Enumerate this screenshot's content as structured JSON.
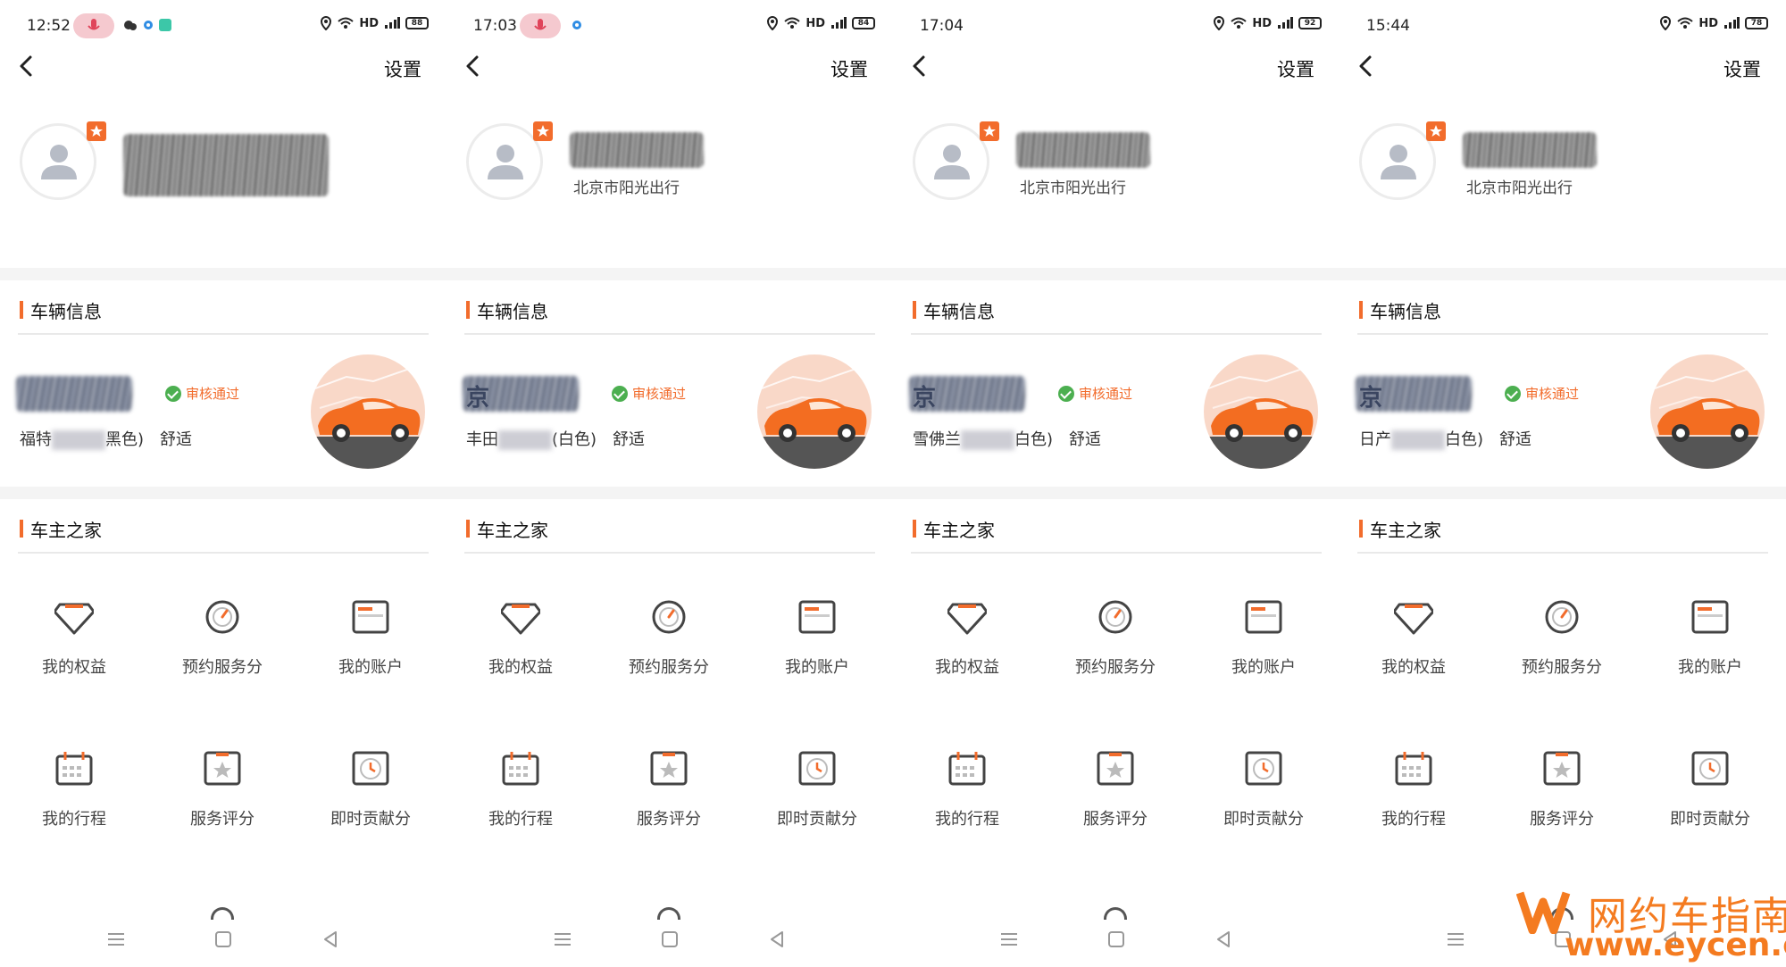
{
  "colors": {
    "accent": "#f26c2c",
    "ok_green": "#4caf50",
    "watermark": "#f47b20"
  },
  "header": {
    "settings_label": "设置"
  },
  "sections": {
    "vehicle_title": "车辆信息",
    "home_title": "车主之家"
  },
  "vehicle_status": "审核通过",
  "service_level": "舒适",
  "grid": [
    {
      "label": "我的权益",
      "icon": "diamond-icon"
    },
    {
      "label": "预约服务分",
      "icon": "speedometer-icon"
    },
    {
      "label": "我的账户",
      "icon": "wallet-card-icon"
    },
    {
      "label": "我的行程",
      "icon": "calendar-icon"
    },
    {
      "label": "服务评分",
      "icon": "star-card-icon"
    },
    {
      "label": "即时贡献分",
      "icon": "clock-icon"
    }
  ],
  "screens": [
    {
      "time": "12:52",
      "battery": "88",
      "company": "",
      "plate_prefix": "",
      "brand": "福特",
      "color": "黑色)"
    },
    {
      "time": "17:03",
      "battery": "84",
      "company": "北京市阳光出行",
      "plate_prefix": "京",
      "brand": "丰田",
      "color": "(白色)"
    },
    {
      "time": "17:04",
      "battery": "92",
      "company": "北京市阳光出行",
      "plate_prefix": "京",
      "brand": "雪佛兰",
      "color": "白色)"
    },
    {
      "time": "15:44",
      "battery": "78",
      "company": "北京市阳光出行",
      "plate_prefix": "京",
      "brand": "日产",
      "color": "白色)"
    }
  ],
  "watermark": {
    "title": "网约车指南",
    "url": "www.eycen.com"
  }
}
